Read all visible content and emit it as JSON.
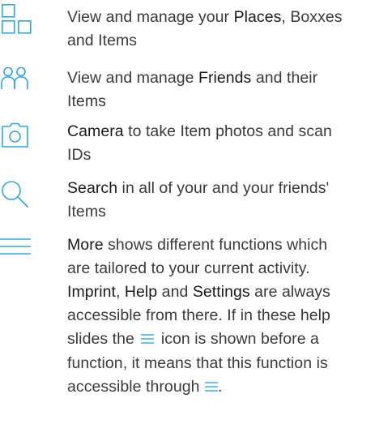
{
  "accent_color": "#2EA6E6",
  "rows": [
    {
      "icon": "grid-icon",
      "keyword": "Places",
      "pre": "View and manage your ",
      "mid": ", Boxxes",
      "line2": "and Items"
    },
    {
      "icon": "friends-icon",
      "keyword": "Friends",
      "pre": "View and manage ",
      "mid": " and their",
      "line2": "Items"
    },
    {
      "icon": "camera-icon",
      "keyword": "Camera",
      "post": " to take Item photos and scan",
      "line2": "IDs"
    },
    {
      "icon": "search-icon",
      "keyword": "Search",
      "post": " in all of your and your friends'",
      "line2": "Items"
    },
    {
      "icon": "menu-icon",
      "keyword": "More",
      "post": " shows different functions which",
      "line2": "are tailored to your current activity.",
      "kw_imprint": "Imprint",
      "sep1": ", ",
      "kw_help": "Help",
      "sep2": " and ",
      "kw_settings": "Settings",
      "line3_post": " are always",
      "line4": "accessible from there. If in these help",
      "line5_pre": "slides the ",
      "line5_post": " icon is shown before a",
      "line6": "function, it means that this function is",
      "line7_pre": "accessible through ",
      "line7_post": "."
    }
  ]
}
